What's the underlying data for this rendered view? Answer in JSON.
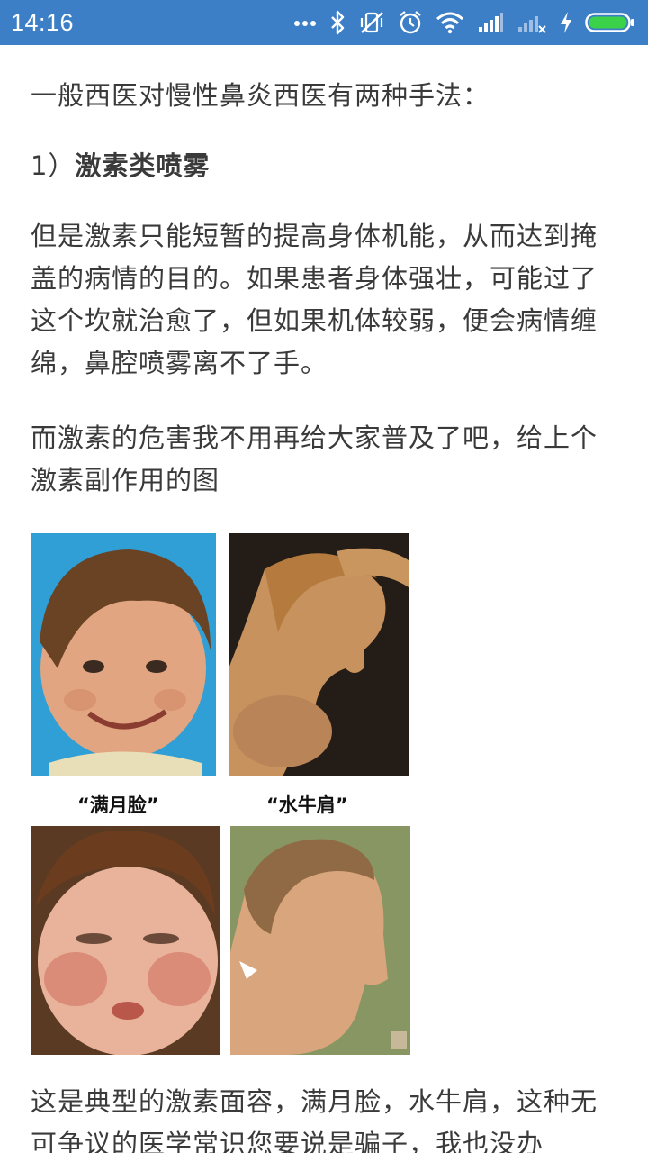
{
  "status_bar": {
    "time": "14:16",
    "icons": [
      "more-dots-icon",
      "bluetooth-icon",
      "vibrate-icon",
      "alarm-icon",
      "wifi-icon",
      "signal-icon",
      "signal-no-sim-icon",
      "charging-icon",
      "battery-icon"
    ],
    "battery_level": 1.0,
    "bar_color": "#3c7fc7",
    "battery_color": "#3bd24a"
  },
  "article": {
    "p1": "一般西医对慢性鼻炎西医有两种手法：",
    "p2_number": "1）",
    "p2_bold": "激素类喷雾",
    "p3": "但是激素只能短暂的提高身体机能，从而达到掩盖的病情的目的。如果患者身体强壮，可能过了这个坎就治愈了，但如果机体较弱，便会病情缠绵，鼻腔喷雾离不了手。",
    "p4": "而激素的危害我不用再给大家普及了吧，给上个激素副作用的图",
    "figure": {
      "caption_left": "“满月脸”",
      "caption_right": "“水牛肩”"
    },
    "p5": "这是典型的激素面容，满月脸，水牛肩，这种无可争议的医学常识您要说是骗子，我也没办"
  }
}
